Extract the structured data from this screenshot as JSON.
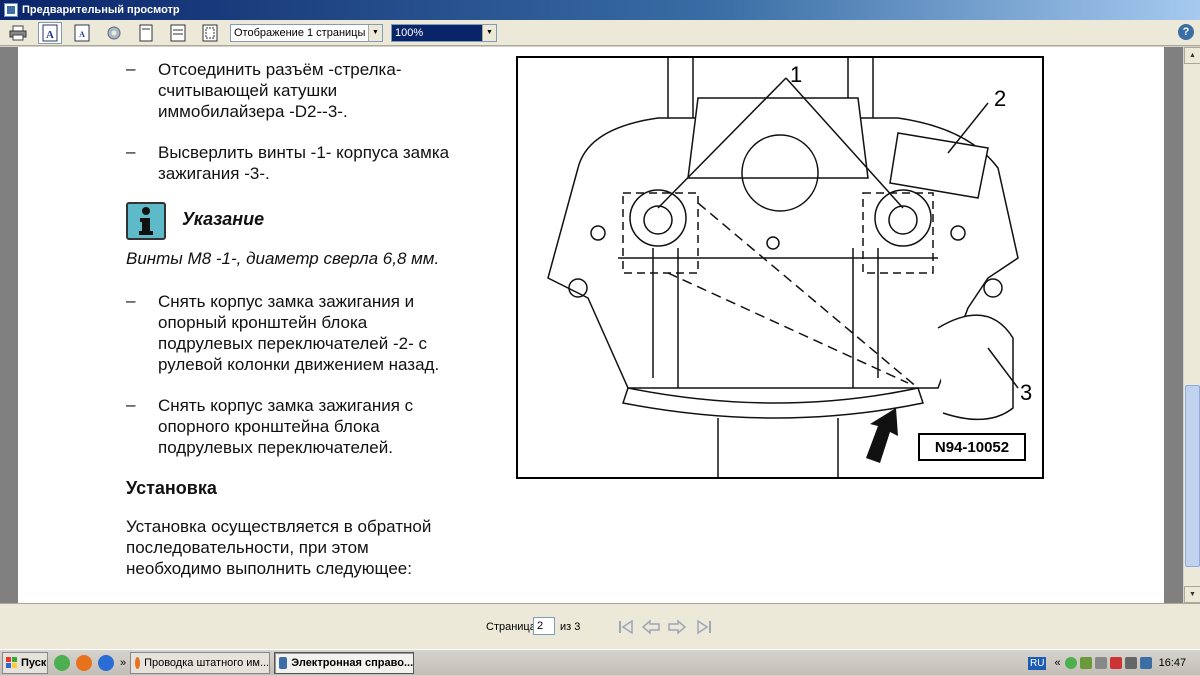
{
  "window": {
    "title": "Предварительный просмотр"
  },
  "toolbar": {
    "page_mode": "Отображение 1 страницы",
    "zoom": "100%",
    "help": "?"
  },
  "content": {
    "bullet_symbol": "–",
    "bullets_top": [
      [
        "Отсоединить разъём -стрелка-",
        "считывающей катушки",
        "иммобилайзера -D2--3-."
      ],
      [
        "Высверлить винты -1- корпуса замка",
        "зажигания -3-."
      ]
    ],
    "note_title": "Указание",
    "note_text": "Винты M8 -1-, диаметр сверла 6,8 мм.",
    "bullets_bottom": [
      [
        "Снять корпус замка зажигания и",
        "опорный кронштейн блока",
        "подрулевых переключателей -2- с",
        "рулевой колонки движением назад."
      ],
      [
        "Снять корпус замка зажигания с",
        "опорного кронштейна блока",
        "подрулевых переключателей."
      ]
    ],
    "section_heading": "Установка",
    "section_text": [
      "Установка осуществляется в обратной",
      "последовательности, при этом",
      "необходимо выполнить следующее:"
    ]
  },
  "figure": {
    "label": "N94-10052",
    "callouts": [
      "1",
      "2",
      "3"
    ]
  },
  "navigation": {
    "page_label": "Страница",
    "current_page": "2",
    "of_label": "из 3"
  },
  "taskbar": {
    "start_label": "Пуск",
    "tasks": [
      "Проводка штатного им...",
      "Электронная справо..."
    ],
    "language": "RU",
    "clock": "16:47",
    "overflow": "»",
    "tray_overflow": "«"
  },
  "colors": {
    "titlebar": "#0a246a",
    "info_icon": "#5eb9c9",
    "toolbar": "#ece9d8"
  }
}
